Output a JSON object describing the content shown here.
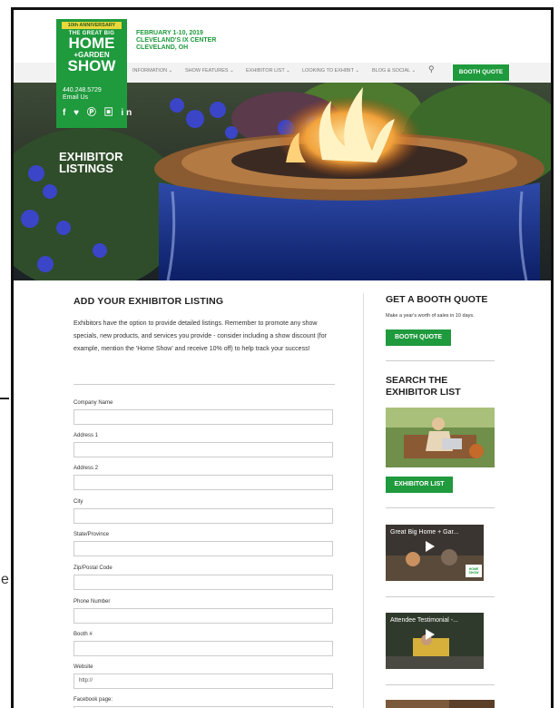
{
  "header": {
    "logo": {
      "anniversary": "10th ANNIVERSARY",
      "line1": "THE GREAT BIG",
      "line2": "HOME",
      "line3": "+GARDEN",
      "line4": "SHOW"
    },
    "phone": "440.248.5729",
    "email": "Email Us",
    "socials": "f ♥ Ⓟ ▣ in",
    "event_dates": "FEBRUARY 1-10, 2019",
    "event_venue": "CLEVELAND'S IX CENTER",
    "event_city": "CLEVELAND, OH",
    "nav": [
      "INFORMATION ⌄",
      "SHOW FEATURES ⌄",
      "EXHIBITOR LIST ⌄",
      "LOOKING TO EXHIBIT ⌄",
      "BLOG & SOCIAL ⌄"
    ],
    "search_icon": "search-icon",
    "booth_quote": "BOOTH QUOTE"
  },
  "hero": {
    "title_line1": "EXHIBITOR",
    "title_line2": "LISTINGS"
  },
  "main": {
    "heading": "ADD YOUR EXHIBITOR LISTING",
    "intro": "Exhibitors have the option to provide detailed listings. Remember to promote any show specials, new products, and services you provide - consider including a show discount (for example, mention the 'Home Show' and receive 10% off) to help track your success!",
    "fields": [
      {
        "label": "Company Name",
        "value": ""
      },
      {
        "label": "Address 1",
        "value": ""
      },
      {
        "label": "Address 2",
        "value": ""
      },
      {
        "label": "City",
        "value": ""
      },
      {
        "label": "State/Province",
        "value": ""
      },
      {
        "label": "Zip/Postal Code",
        "value": ""
      },
      {
        "label": "Phone Number",
        "value": ""
      },
      {
        "label": "Booth #",
        "value": ""
      },
      {
        "label": "Website",
        "value": "http://"
      },
      {
        "label": "Facebook page:",
        "value": ""
      }
    ]
  },
  "sidebar": {
    "quote_heading": "GET A BOOTH QUOTE",
    "quote_text": "Make a year's worth of sales in 10 days.",
    "quote_button": "BOOTH QUOTE",
    "search_heading_1": "SEARCH THE",
    "search_heading_2": "EXHIBITOR LIST",
    "list_button": "EXHIBITOR LIST",
    "video1_title": "Great Big Home + Gar...",
    "video1_badge": "HOME SHOW",
    "video2_title": "Attendee Testimonial -..."
  },
  "colors": {
    "brand_green": "#1f9a3d",
    "gold": "#e8d83a"
  }
}
